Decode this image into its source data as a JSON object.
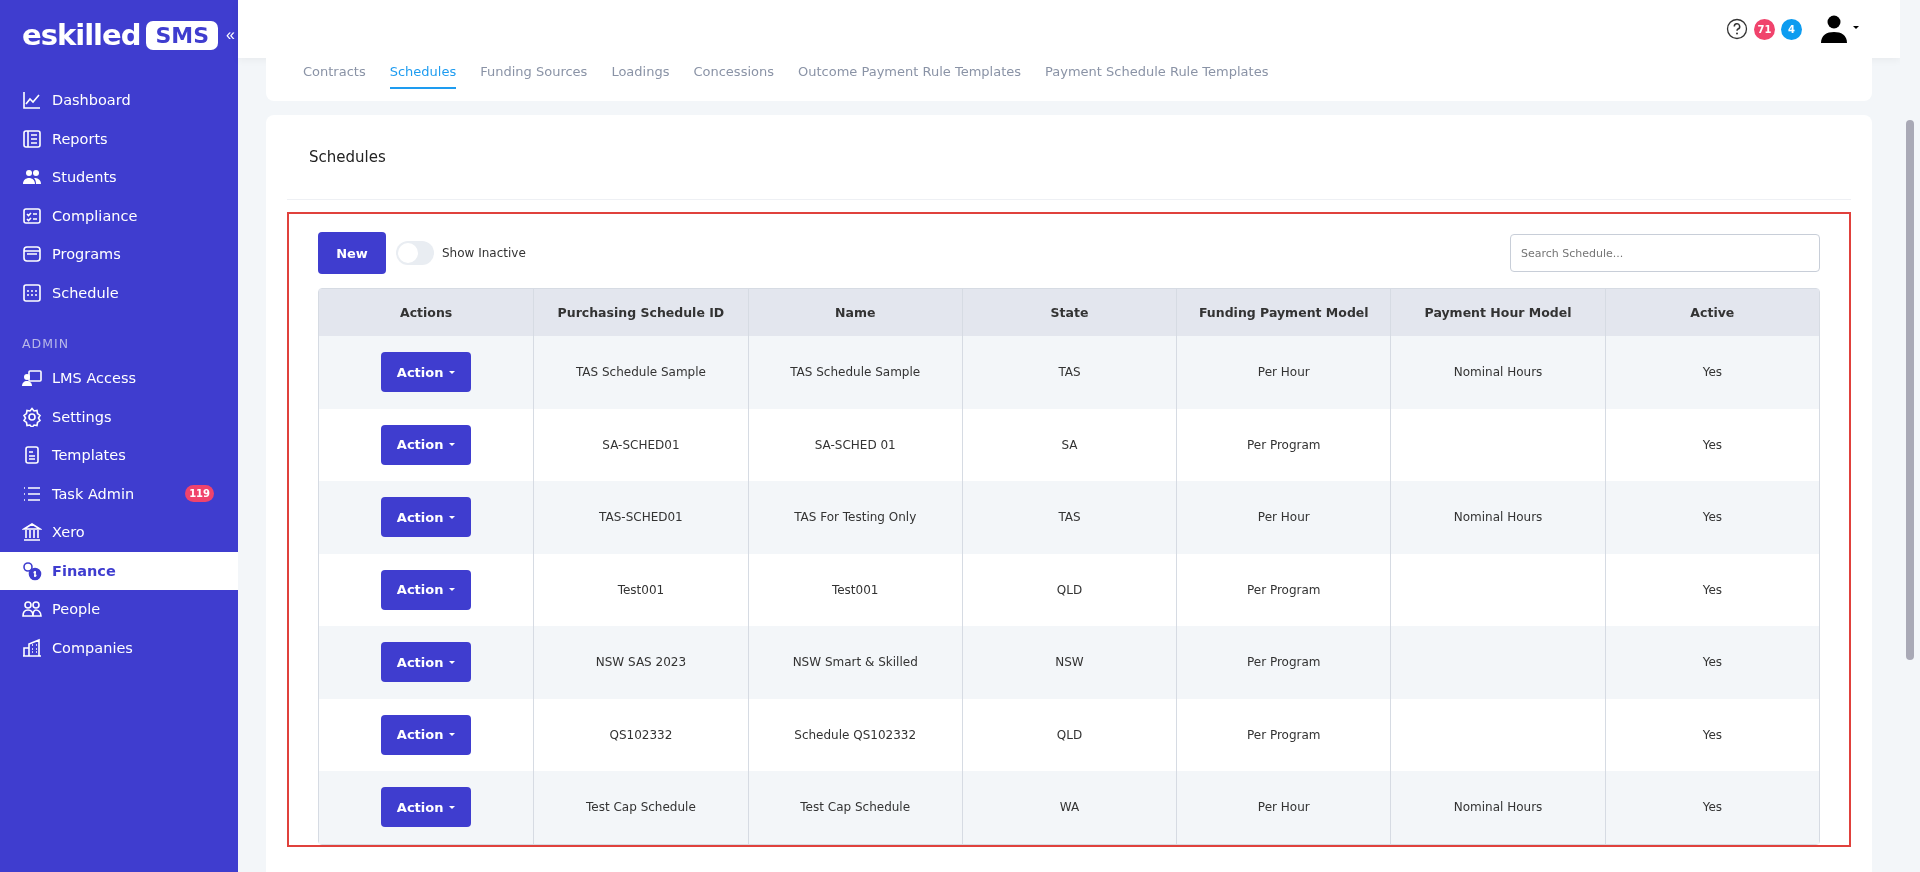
{
  "brand": {
    "name": "eskilled",
    "badge": "SMS",
    "collapse": "«"
  },
  "sidebar": {
    "items": [
      {
        "label": "Dashboard",
        "selected": false
      },
      {
        "label": "Reports",
        "selected": false
      },
      {
        "label": "Students",
        "selected": false
      },
      {
        "label": "Compliance",
        "selected": false
      },
      {
        "label": "Programs",
        "selected": false
      },
      {
        "label": "Schedule",
        "selected": false
      }
    ],
    "section": "ADMIN",
    "admin_items": [
      {
        "label": "LMS Access",
        "selected": false
      },
      {
        "label": "Settings",
        "selected": false
      },
      {
        "label": "Templates",
        "selected": false
      },
      {
        "label": "Task Admin",
        "selected": false,
        "badge": "119"
      },
      {
        "label": "Xero",
        "selected": false
      },
      {
        "label": "Finance",
        "selected": true
      },
      {
        "label": "People",
        "selected": false
      },
      {
        "label": "Companies",
        "selected": false
      }
    ]
  },
  "header": {
    "badges": [
      {
        "count": "71",
        "color": "#f0436c"
      },
      {
        "count": "4",
        "color": "#0d9cf0"
      }
    ]
  },
  "tabs": [
    {
      "label": "Contracts",
      "selected": false
    },
    {
      "label": "Schedules",
      "selected": true
    },
    {
      "label": "Funding Sources",
      "selected": false
    },
    {
      "label": "Loadings",
      "selected": false
    },
    {
      "label": "Concessions",
      "selected": false
    },
    {
      "label": "Outcome Payment Rule Templates",
      "selected": false
    },
    {
      "label": "Payment Schedule Rule Templates",
      "selected": false
    }
  ],
  "panel": {
    "title": "Schedules"
  },
  "toolbar": {
    "new_button": "New",
    "toggle": {
      "label": "Show Inactive",
      "on": false
    },
    "search": {
      "placeholder": "Search Schedule..."
    }
  },
  "table": {
    "columns": [
      "Actions",
      "Purchasing Schedule ID",
      "Name",
      "State",
      "Funding Payment Model",
      "Payment Hour Model",
      "Active"
    ],
    "rows": [
      {
        "action": "Action",
        "id": "TAS Schedule Sample",
        "name": "TAS Schedule Sample",
        "state": "TAS",
        "funding": "Per Hour",
        "hour_model": "Nominal Hours",
        "active": "Yes"
      },
      {
        "action": "Action",
        "id": "SA-SCHED01",
        "name": "SA-SCHED 01",
        "state": "SA",
        "funding": "Per Program",
        "hour_model": "",
        "active": "Yes"
      },
      {
        "action": "Action",
        "id": "TAS-SCHED01",
        "name": "TAS For Testing Only",
        "state": "TAS",
        "funding": "Per Hour",
        "hour_model": "Nominal Hours",
        "active": "Yes"
      },
      {
        "action": "Action",
        "id": "Test001",
        "name": "Test001",
        "state": "QLD",
        "funding": "Per Program",
        "hour_model": "",
        "active": "Yes"
      },
      {
        "action": "Action",
        "id": "NSW SAS 2023",
        "name": "NSW Smart & Skilled",
        "state": "NSW",
        "funding": "Per Program",
        "hour_model": "",
        "active": "Yes"
      },
      {
        "action": "Action",
        "id": "QS102332",
        "name": "Schedule QS102332",
        "state": "QLD",
        "funding": "Per Program",
        "hour_model": "",
        "active": "Yes"
      },
      {
        "action": "Action",
        "id": "Test Cap Schedule",
        "name": "Test Cap Schedule",
        "state": "WA",
        "funding": "Per Hour",
        "hour_model": "Nominal Hours",
        "active": "Yes"
      }
    ]
  }
}
